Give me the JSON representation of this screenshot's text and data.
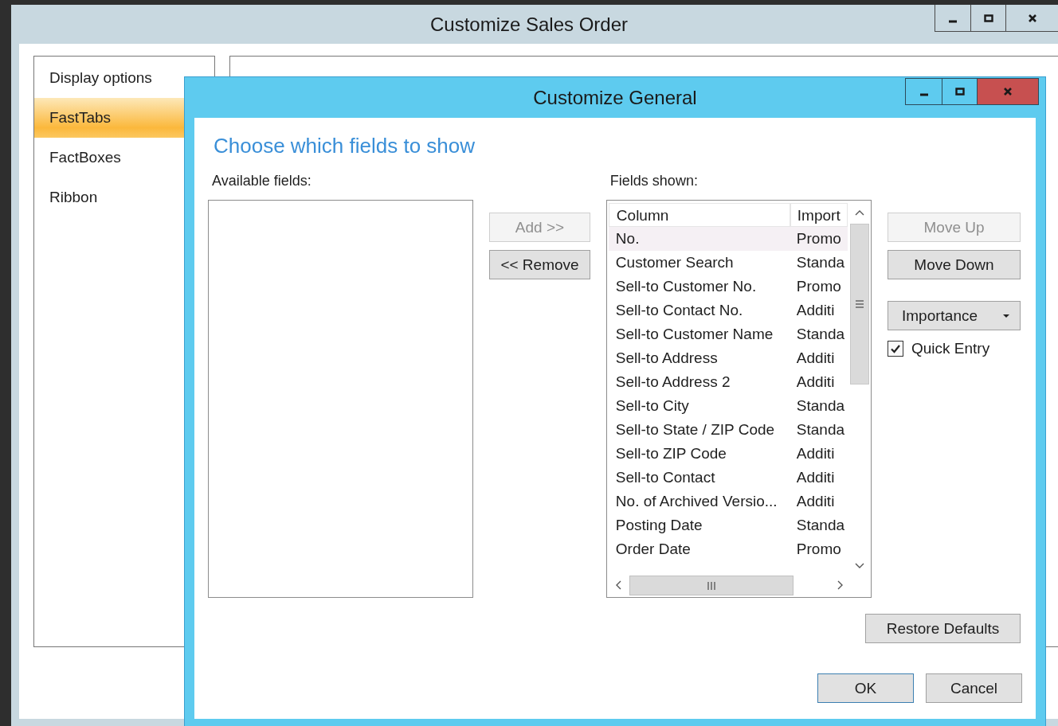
{
  "window": {
    "title": "Customize Sales Order"
  },
  "sidebar": {
    "items": [
      {
        "label": "Display options",
        "selected": false
      },
      {
        "label": "FastTabs",
        "selected": true
      },
      {
        "label": "FactBoxes",
        "selected": false
      },
      {
        "label": "Ribbon",
        "selected": false
      }
    ]
  },
  "dialog": {
    "title": "Customize General",
    "heading": "Choose which fields to show",
    "available_fields": {
      "label": "Available fields:"
    },
    "transfer_buttons": [
      {
        "label": "Add >>",
        "disabled": true
      },
      {
        "label": "<< Remove",
        "disabled": false
      }
    ],
    "fields_shown": {
      "label": "Fields shown:",
      "columns": [
        "Column",
        "Import"
      ],
      "rows": [
        {
          "cells": [
            "No.",
            "Promo"
          ],
          "selected": true
        },
        {
          "cells": [
            "Customer Search",
            "Standa"
          ],
          "selected": false
        },
        {
          "cells": [
            "Sell-to Customer No.",
            "Promo"
          ],
          "selected": false
        },
        {
          "cells": [
            "Sell-to Contact No.",
            "Additi"
          ],
          "selected": false
        },
        {
          "cells": [
            "Sell-to Customer Name",
            "Standa"
          ],
          "selected": false
        },
        {
          "cells": [
            "Sell-to Address",
            "Additi"
          ],
          "selected": false
        },
        {
          "cells": [
            "Sell-to Address 2",
            "Additi"
          ],
          "selected": false
        },
        {
          "cells": [
            "Sell-to City",
            "Standa"
          ],
          "selected": false
        },
        {
          "cells": [
            "Sell-to State / ZIP Code",
            "Standa"
          ],
          "selected": false
        },
        {
          "cells": [
            "Sell-to ZIP Code",
            "Additi"
          ],
          "selected": false
        },
        {
          "cells": [
            "Sell-to Contact",
            "Additi"
          ],
          "selected": false
        },
        {
          "cells": [
            "No. of Archived Versio...",
            "Additi"
          ],
          "selected": false
        },
        {
          "cells": [
            "Posting Date",
            "Standa"
          ],
          "selected": false
        },
        {
          "cells": [
            "Order Date",
            "Promo"
          ],
          "selected": false
        }
      ]
    },
    "side_controls": [
      {
        "kind": "button",
        "label": "Move Up",
        "disabled": true
      },
      {
        "kind": "button",
        "label": "Move Down",
        "disabled": false
      },
      {
        "kind": "dropdown",
        "label": "Importance",
        "disabled": false
      },
      {
        "kind": "checkbox",
        "label": "Quick Entry",
        "checked": true
      }
    ],
    "restore_button": {
      "label": "Restore Defaults"
    },
    "buttons": [
      {
        "label": "OK",
        "default": true
      },
      {
        "label": "Cancel",
        "default": false
      }
    ]
  }
}
